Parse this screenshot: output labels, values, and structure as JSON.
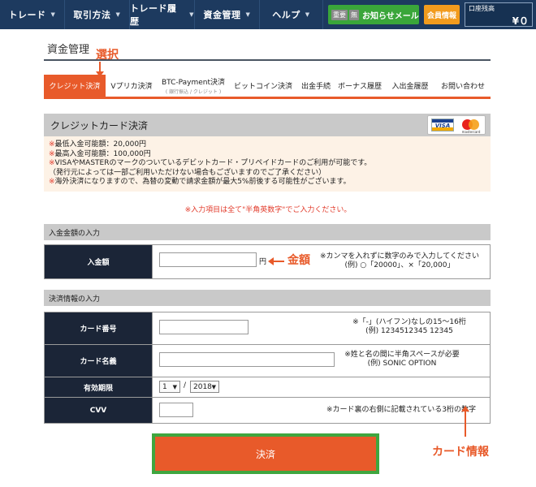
{
  "nav": {
    "items": [
      {
        "label": "トレード"
      },
      {
        "label": "取引方法"
      },
      {
        "label": "トレード履歴"
      },
      {
        "label": "資金管理"
      },
      {
        "label": "ヘルプ"
      }
    ],
    "dropdown_icon": "triangle-down-icon",
    "notice": {
      "tag1": "重要",
      "tag2": "無",
      "label": "お知らせメール"
    },
    "member_label": "会員情報",
    "balance": {
      "label": "口座残高",
      "value": "¥０"
    }
  },
  "header": {
    "title": "資金管理",
    "annotation_select": "選択"
  },
  "tabs": [
    {
      "label": "クレジット決済",
      "active": true
    },
    {
      "label": "Vプリカ決済"
    },
    {
      "label": "BTC-Payment決済",
      "sub": "( 銀行振込 / クレジット )"
    },
    {
      "label": "ビットコイン決済"
    },
    {
      "label": "出金手続"
    },
    {
      "label": "ボーナス履歴"
    },
    {
      "label": "入出金履歴"
    },
    {
      "label": "お問い合わせ"
    }
  ],
  "credit": {
    "title": "クレジットカード決済",
    "visa_text": "VISA",
    "mc_text": "mastercard",
    "notes": [
      {
        "mark": "※",
        "text": "最低入金可能額：20,000円"
      },
      {
        "mark": "※",
        "text": "最高入金可能額：100,000円"
      },
      {
        "mark": "※",
        "text": "VISAやMASTERのマークのついているデビットカード・プリペイドカードのご利用が可能です。"
      },
      {
        "mark": "",
        "text": "（発行元によっては一部ご利用いただけない場合もございますのでご了承ください）"
      },
      {
        "mark": "※",
        "text": "海外決済になりますので、為替の変動で請求金額が最大5%前後する可能性がございます。"
      }
    ]
  },
  "input_note": "※入力項目は全て\"半角英数字\"でご入力ください。",
  "amount_section": {
    "title": "入金金額の入力",
    "label": "入金額",
    "unit": "円",
    "annotation": "金額",
    "hint1": "※カンマを入れずに数字のみで入力してください",
    "hint2": "(例) ○「20000」、×「20,000」"
  },
  "payment_section": {
    "title": "決済情報の入力",
    "card_number": {
      "label": "カード番号",
      "hint1": "※「-」(ハイフン)なしの15～16桁",
      "hint2": "(例) 1234512345 12345"
    },
    "card_name": {
      "label": "カード名義",
      "hint1": "※姓と名の間に半角スペースが必要",
      "hint2": "(例) SONIC OPTION"
    },
    "expiry": {
      "label": "有効期限",
      "month": "1",
      "separator": "/",
      "year": "2018"
    },
    "cvv": {
      "label": "CVV",
      "hint": "※カード裏の右側に記載されている3桁の数字"
    }
  },
  "submit_label": "決済",
  "annotation_card": "カード情報"
}
